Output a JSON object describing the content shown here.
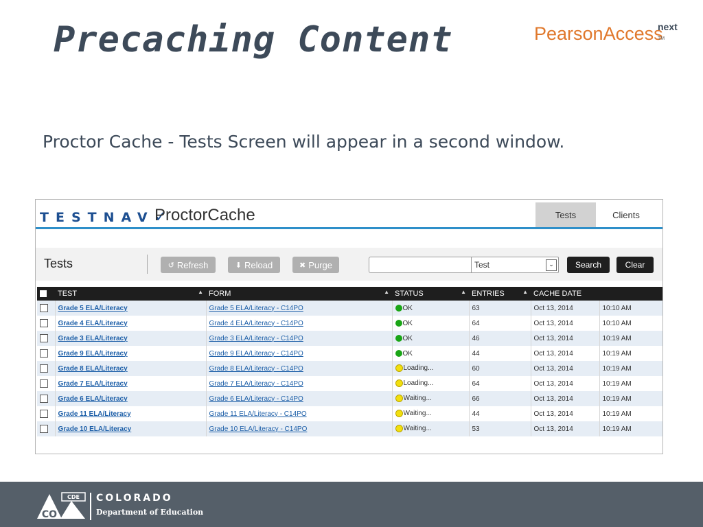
{
  "slide": {
    "title": "Precaching Content",
    "subtitle": "Proctor Cache - Tests Screen will appear in a second window.",
    "logo": {
      "brand": "PearsonAccess",
      "superscript": "next",
      "trademark": "TM"
    }
  },
  "app": {
    "logo_text": "TESTNAV",
    "logo_check": "✓",
    "name": "ProctorCache",
    "tabs": [
      {
        "label": "Tests",
        "active": true
      },
      {
        "label": "Clients",
        "active": false
      }
    ],
    "toolbar": {
      "title": "Tests",
      "refresh_label": "Refresh",
      "reload_label": "Reload",
      "purge_label": "Purge",
      "search_value": "",
      "filter_selected": "Test",
      "search_label": "Search",
      "clear_label": "Clear"
    },
    "columns": [
      "TEST",
      "FORM",
      "STATUS",
      "ENTRIES",
      "CACHE DATE"
    ],
    "rows": [
      {
        "test": "Grade 5 ELA/Literacy",
        "form": "Grade 5 ELA/Literacy - C14PO",
        "status": "OK",
        "status_color": "#1aa516",
        "entries": "63",
        "date": "Oct 13, 2014",
        "time": "10:10 AM"
      },
      {
        "test": "Grade 4 ELA/Literacy",
        "form": "Grade 4 ELA/Literacy - C14PO",
        "status": "OK",
        "status_color": "#1aa516",
        "entries": "64",
        "date": "Oct 13, 2014",
        "time": "10:10 AM"
      },
      {
        "test": "Grade 3 ELA/Literacy",
        "form": "Grade 3 ELA/Literacy - C14PO",
        "status": "OK",
        "status_color": "#1aa516",
        "entries": "46",
        "date": "Oct 13, 2014",
        "time": "10:19 AM"
      },
      {
        "test": "Grade 9 ELA/Literacy",
        "form": "Grade 9 ELA/Literacy - C14PO",
        "status": "OK",
        "status_color": "#1aa516",
        "entries": "44",
        "date": "Oct 13, 2014",
        "time": "10:19 AM"
      },
      {
        "test": "Grade 8 ELA/Literacy",
        "form": "Grade 8 ELA/Literacy - C14PO",
        "status": "Loading...",
        "status_color": "#f2df0e",
        "entries": "60",
        "date": "Oct 13, 2014",
        "time": "10:19 AM"
      },
      {
        "test": "Grade 7 ELA/Literacy",
        "form": "Grade 7 ELA/Literacy - C14PO",
        "status": "Loading...",
        "status_color": "#f2df0e",
        "entries": "64",
        "date": "Oct 13, 2014",
        "time": "10:19 AM"
      },
      {
        "test": "Grade 6 ELA/Literacy",
        "form": "Grade 6 ELA/Literacy - C14PO",
        "status": "Waiting...",
        "status_color": "#f2df0e",
        "entries": "66",
        "date": "Oct 13, 2014",
        "time": "10:19 AM"
      },
      {
        "test": "Grade 11 ELA/Literacy",
        "form": "Grade 11 ELA/Literacy - C14PO",
        "status": "Waiting...",
        "status_color": "#f2df0e",
        "entries": "44",
        "date": "Oct 13, 2014",
        "time": "10:19 AM"
      },
      {
        "test": "Grade 10 ELA/Literacy",
        "form": "Grade 10 ELA/Literacy - C14PO",
        "status": "Waiting...",
        "status_color": "#f2df0e",
        "entries": "53",
        "date": "Oct 13, 2014",
        "time": "10:19 AM"
      }
    ]
  },
  "footer": {
    "mark_top": "CDE",
    "mark_bottom": "CO",
    "org": "COLORADO",
    "dept": "Department of Education"
  },
  "colors": {
    "title": "#3d4a59",
    "brand_orange": "#e0782c",
    "header_rule": "#2e8fc9",
    "table_header": "#1e1e1e",
    "row_alt": "#e6edf5",
    "link": "#1d5fa8",
    "footer_bg": "#555f69"
  }
}
